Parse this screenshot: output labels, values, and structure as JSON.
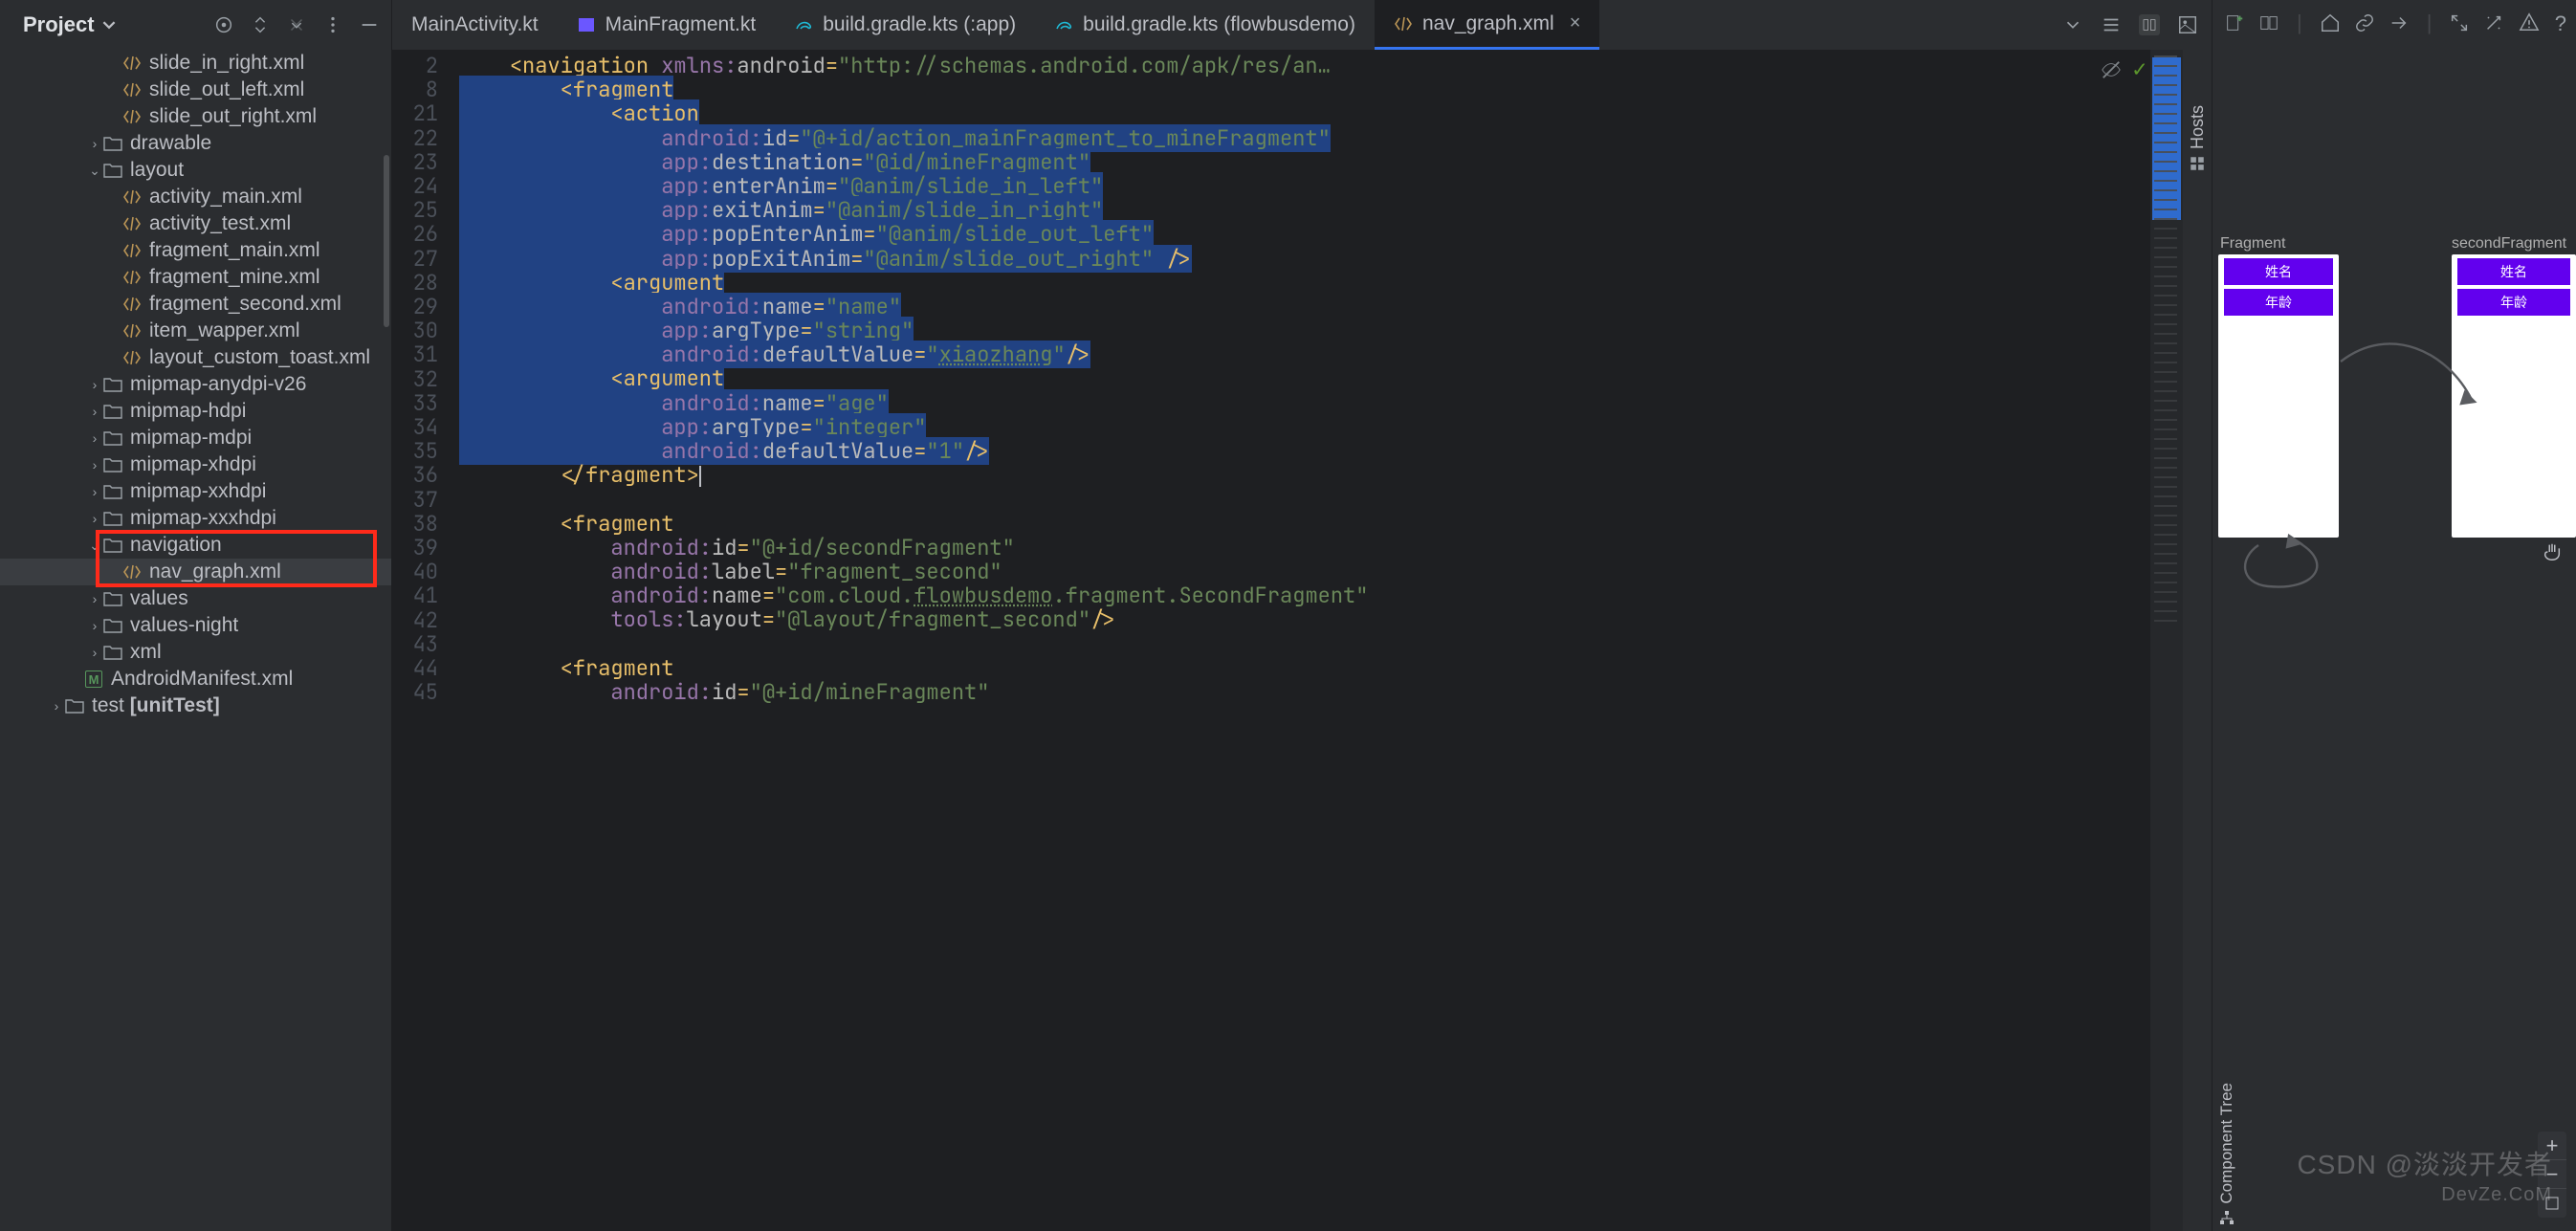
{
  "project": {
    "title": "Project",
    "tree": [
      {
        "depth": 5,
        "icon": "xml",
        "label": "slide_in_right.xml"
      },
      {
        "depth": 5,
        "icon": "xml",
        "label": "slide_out_left.xml"
      },
      {
        "depth": 5,
        "icon": "xml",
        "label": "slide_out_right.xml"
      },
      {
        "depth": 4,
        "icon": "folder",
        "label": "drawable",
        "chev": "right"
      },
      {
        "depth": 4,
        "icon": "folder",
        "label": "layout",
        "chev": "down"
      },
      {
        "depth": 5,
        "icon": "xml",
        "label": "activity_main.xml"
      },
      {
        "depth": 5,
        "icon": "xml",
        "label": "activity_test.xml"
      },
      {
        "depth": 5,
        "icon": "xml",
        "label": "fragment_main.xml"
      },
      {
        "depth": 5,
        "icon": "xml",
        "label": "fragment_mine.xml"
      },
      {
        "depth": 5,
        "icon": "xml",
        "label": "fragment_second.xml"
      },
      {
        "depth": 5,
        "icon": "xml",
        "label": "item_wapper.xml"
      },
      {
        "depth": 5,
        "icon": "xml",
        "label": "layout_custom_toast.xml"
      },
      {
        "depth": 4,
        "icon": "folder",
        "label": "mipmap-anydpi-v26",
        "chev": "right"
      },
      {
        "depth": 4,
        "icon": "folder",
        "label": "mipmap-hdpi",
        "chev": "right"
      },
      {
        "depth": 4,
        "icon": "folder",
        "label": "mipmap-mdpi",
        "chev": "right"
      },
      {
        "depth": 4,
        "icon": "folder",
        "label": "mipmap-xhdpi",
        "chev": "right"
      },
      {
        "depth": 4,
        "icon": "folder",
        "label": "mipmap-xxhdpi",
        "chev": "right"
      },
      {
        "depth": 4,
        "icon": "folder",
        "label": "mipmap-xxxhdpi",
        "chev": "right"
      },
      {
        "depth": 4,
        "icon": "folder",
        "label": "navigation",
        "chev": "down",
        "hl": true
      },
      {
        "depth": 5,
        "icon": "xml",
        "label": "nav_graph.xml",
        "sel": true,
        "hl": true
      },
      {
        "depth": 4,
        "icon": "folder",
        "label": "values",
        "chev": "right"
      },
      {
        "depth": 4,
        "icon": "folder",
        "label": "values-night",
        "chev": "right"
      },
      {
        "depth": 4,
        "icon": "folder",
        "label": "xml",
        "chev": "right"
      },
      {
        "depth": 3,
        "icon": "m",
        "label": "AndroidManifest.xml"
      },
      {
        "depth": 2,
        "icon": "folder",
        "label": "test [unitTest]",
        "chev": "right",
        "bold": true
      }
    ],
    "highlight_rows": [
      18,
      19
    ]
  },
  "tabs": [
    {
      "icon": "",
      "label": "MainActivity.kt"
    },
    {
      "icon": "kt",
      "label": "MainFragment.kt"
    },
    {
      "icon": "gradle",
      "label": "build.gradle.kts (:app)"
    },
    {
      "icon": "gradle",
      "label": "build.gradle.kts (flowbusdemo)"
    },
    {
      "icon": "xml",
      "label": "nav_graph.xml",
      "active": true,
      "closable": true
    }
  ],
  "gutter": [
    "2",
    "8",
    "21",
    "22",
    "23",
    "24",
    "25",
    "26",
    "27",
    "28",
    "29",
    "30",
    "31",
    "32",
    "33",
    "34",
    "35",
    "36",
    "37",
    "38",
    "39",
    "40",
    "41",
    "42",
    "43",
    "44",
    "45"
  ],
  "code": [
    {
      "sel": false,
      "seg": [
        [
          "    ",
          ""
        ],
        [
          "<navigation ",
          "tag"
        ],
        [
          "xmlns:",
          "attr-ns"
        ],
        [
          "android",
          "attr"
        ],
        [
          "=",
          "pun"
        ],
        [
          "\"http://schemas.android.com/apk/res/an…",
          "str"
        ]
      ]
    },
    {
      "sel": true,
      "seg": [
        [
          "        ",
          ""
        ],
        [
          "<fragment",
          "tag"
        ]
      ]
    },
    {
      "sel": true,
      "seg": [
        [
          "            ",
          ""
        ],
        [
          "<action",
          "tag"
        ]
      ]
    },
    {
      "sel": true,
      "seg": [
        [
          "                ",
          ""
        ],
        [
          "android:",
          "attr-ns"
        ],
        [
          "id",
          "attr"
        ],
        [
          "=",
          "pun"
        ],
        [
          "\"@+id/action_mainFragment_to_mineFragment\"",
          "str"
        ]
      ]
    },
    {
      "sel": true,
      "seg": [
        [
          "                ",
          ""
        ],
        [
          "app:",
          "attr-ns"
        ],
        [
          "destination",
          "attr"
        ],
        [
          "=",
          "pun"
        ],
        [
          "\"@id/mineFragment\"",
          "str"
        ]
      ]
    },
    {
      "sel": true,
      "seg": [
        [
          "                ",
          ""
        ],
        [
          "app:",
          "attr-ns"
        ],
        [
          "enterAnim",
          "attr"
        ],
        [
          "=",
          "pun"
        ],
        [
          "\"@anim/slide_in_left\"",
          "str"
        ]
      ]
    },
    {
      "sel": true,
      "seg": [
        [
          "                ",
          ""
        ],
        [
          "app:",
          "attr-ns"
        ],
        [
          "exitAnim",
          "attr"
        ],
        [
          "=",
          "pun"
        ],
        [
          "\"@anim/slide_in_right\"",
          "str"
        ]
      ]
    },
    {
      "sel": true,
      "seg": [
        [
          "                ",
          ""
        ],
        [
          "app:",
          "attr-ns"
        ],
        [
          "popEnterAnim",
          "attr"
        ],
        [
          "=",
          "pun"
        ],
        [
          "\"@anim/slide_out_left\"",
          "str"
        ]
      ]
    },
    {
      "sel": true,
      "seg": [
        [
          "                ",
          ""
        ],
        [
          "app:",
          "attr-ns"
        ],
        [
          "popExitAnim",
          "attr"
        ],
        [
          "=",
          "pun"
        ],
        [
          "\"@anim/slide_out_right\"",
          "str"
        ],
        [
          " />",
          "tag"
        ]
      ]
    },
    {
      "sel": true,
      "seg": [
        [
          "            ",
          ""
        ],
        [
          "<argument",
          "tag"
        ]
      ]
    },
    {
      "sel": true,
      "seg": [
        [
          "                ",
          ""
        ],
        [
          "android:",
          "attr-ns"
        ],
        [
          "name",
          "attr"
        ],
        [
          "=",
          "pun"
        ],
        [
          "\"name\"",
          "str"
        ]
      ]
    },
    {
      "sel": true,
      "seg": [
        [
          "                ",
          ""
        ],
        [
          "app:",
          "attr-ns"
        ],
        [
          "argType",
          "attr"
        ],
        [
          "=",
          "pun"
        ],
        [
          "\"string\"",
          "str"
        ]
      ]
    },
    {
      "sel": true,
      "seg": [
        [
          "                ",
          ""
        ],
        [
          "android:",
          "attr-ns"
        ],
        [
          "defaultValue",
          "attr"
        ],
        [
          "=",
          "pun"
        ],
        [
          "\"",
          "str"
        ],
        [
          "xiaozhang",
          "str under"
        ],
        [
          "\"",
          "str"
        ],
        [
          "/>",
          "tag"
        ]
      ]
    },
    {
      "sel": true,
      "seg": [
        [
          "            ",
          ""
        ],
        [
          "<argument",
          "tag"
        ]
      ]
    },
    {
      "sel": true,
      "seg": [
        [
          "                ",
          ""
        ],
        [
          "android:",
          "attr-ns"
        ],
        [
          "name",
          "attr"
        ],
        [
          "=",
          "pun"
        ],
        [
          "\"age\"",
          "str"
        ]
      ]
    },
    {
      "sel": true,
      "seg": [
        [
          "                ",
          ""
        ],
        [
          "app:",
          "attr-ns"
        ],
        [
          "argType",
          "attr"
        ],
        [
          "=",
          "pun"
        ],
        [
          "\"integer\"",
          "str"
        ]
      ]
    },
    {
      "sel": true,
      "seg": [
        [
          "                ",
          ""
        ],
        [
          "android:",
          "attr-ns"
        ],
        [
          "defaultValue",
          "attr"
        ],
        [
          "=",
          "pun"
        ],
        [
          "\"1\"",
          "str"
        ],
        [
          "/>",
          "tag"
        ]
      ]
    },
    {
      "sel": false,
      "seg": [
        [
          "        ",
          ""
        ],
        [
          "</fragment>",
          "tag"
        ]
      ],
      "cursor": true
    },
    {
      "sel": false,
      "seg": [
        [
          "",
          ""
        ]
      ]
    },
    {
      "sel": false,
      "seg": [
        [
          "        ",
          ""
        ],
        [
          "<fragment",
          "tag"
        ]
      ]
    },
    {
      "sel": false,
      "seg": [
        [
          "            ",
          ""
        ],
        [
          "android:",
          "attr-ns"
        ],
        [
          "id",
          "attr"
        ],
        [
          "=",
          "pun"
        ],
        [
          "\"@+id/secondFragment\"",
          "str"
        ]
      ]
    },
    {
      "sel": false,
      "seg": [
        [
          "            ",
          ""
        ],
        [
          "android:",
          "attr-ns"
        ],
        [
          "label",
          "attr"
        ],
        [
          "=",
          "pun"
        ],
        [
          "\"fragment_second\"",
          "str"
        ]
      ]
    },
    {
      "sel": false,
      "seg": [
        [
          "            ",
          ""
        ],
        [
          "android:",
          "attr-ns"
        ],
        [
          "name",
          "attr"
        ],
        [
          "=",
          "pun"
        ],
        [
          "\"com.cloud.",
          "str"
        ],
        [
          "flowbusdemo",
          "str under"
        ],
        [
          ".fragment.SecondFragment\"",
          "str"
        ]
      ]
    },
    {
      "sel": false,
      "seg": [
        [
          "            ",
          ""
        ],
        [
          "tools:",
          "attr-ns"
        ],
        [
          "layout",
          "attr"
        ],
        [
          "=",
          "pun"
        ],
        [
          "\"@layout/fragment_second\"",
          "str"
        ],
        [
          "/>",
          "tag"
        ]
      ]
    },
    {
      "sel": false,
      "seg": [
        [
          "",
          ""
        ]
      ]
    },
    {
      "sel": false,
      "seg": [
        [
          "        ",
          ""
        ],
        [
          "<fragment",
          "tag"
        ]
      ]
    },
    {
      "sel": false,
      "seg": [
        [
          "            ",
          ""
        ],
        [
          "android:",
          "attr-ns"
        ],
        [
          "id",
          "attr"
        ],
        [
          "=",
          "pun"
        ],
        [
          "\"@+id/mineFragment\"",
          "str"
        ]
      ]
    }
  ],
  "hosts_label": "Hosts",
  "design": {
    "frag1_label": "Fragment",
    "frag2_label": "secondFragment",
    "btn_name": "姓名",
    "btn_age": "年龄",
    "component_tree": "Component Tree"
  },
  "watermark": {
    "line1": "CSDN @淡淡开发者",
    "line2": "DevZe.CoM"
  }
}
